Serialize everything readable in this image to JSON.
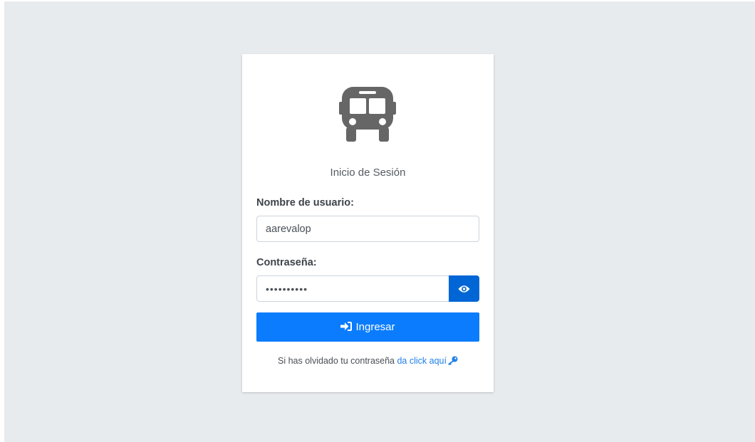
{
  "login": {
    "title": "Inicio de Sesión",
    "username_label": "Nombre de usuario:",
    "username_value": "aarevalop",
    "password_label": "Contraseña:",
    "password_value": "••••••••••",
    "submit_label": "Ingresar",
    "forgot_text": "Si has olvidado tu contraseña ",
    "forgot_link": "da click aquí"
  },
  "icons": {
    "logo": "bus-icon",
    "toggle_password": "eye-icon",
    "submit": "sign-in-icon",
    "forgot": "key-icon"
  },
  "colors": {
    "background": "#e8ebee",
    "primary": "#0a7cfd",
    "eye_button": "#0066d6",
    "link": "#1f7fe8",
    "icon_gray": "#666666"
  }
}
